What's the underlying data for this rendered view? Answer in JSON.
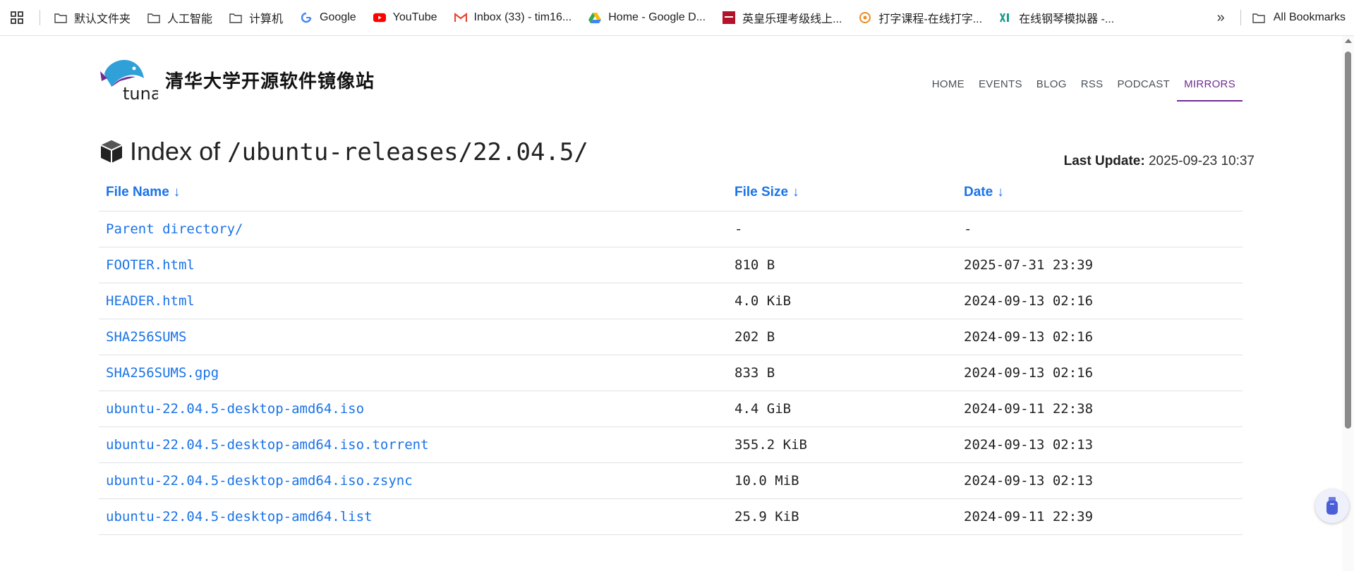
{
  "bookmarks": {
    "items": [
      {
        "label": "默认文件夹",
        "icon": "folder-icon"
      },
      {
        "label": "人工智能",
        "icon": "folder-icon"
      },
      {
        "label": "计算机",
        "icon": "folder-icon"
      },
      {
        "label": "Google",
        "icon": "google-icon"
      },
      {
        "label": "YouTube",
        "icon": "youtube-icon"
      },
      {
        "label": "Inbox (33) - tim16...",
        "icon": "gmail-icon"
      },
      {
        "label": "Home - Google D...",
        "icon": "google-drive-icon"
      },
      {
        "label": "英皇乐理考级线上...",
        "icon": "abrsm-icon"
      },
      {
        "label": "打字课程-在线打字...",
        "icon": "typing-icon"
      },
      {
        "label": "在线钢琴模拟器 -...",
        "icon": "piano-icon"
      }
    ],
    "all_bookmarks": "All Bookmarks"
  },
  "site": {
    "logo_text": "tuna",
    "title": "清华大学开源软件镜像站",
    "nav": [
      "HOME",
      "EVENTS",
      "BLOG",
      "RSS",
      "PODCAST",
      "MIRRORS"
    ],
    "active_nav": "MIRRORS",
    "accent_color": "#6f2d91",
    "link_color": "#1a73e8"
  },
  "index": {
    "prefix": "Index of",
    "path": "/ubuntu-releases/22.04.5/",
    "last_update_label": "Last Update:",
    "last_update_value": "2025-09-23 10:37"
  },
  "table": {
    "headers": [
      "File Name",
      "File Size",
      "Date"
    ],
    "sort_arrow": "↓",
    "rows": [
      {
        "name": "Parent directory/",
        "size": "-",
        "date": "-"
      },
      {
        "name": "FOOTER.html",
        "size": "810 B",
        "date": "2025-07-31 23:39"
      },
      {
        "name": "HEADER.html",
        "size": "4.0 KiB",
        "date": "2024-09-13 02:16"
      },
      {
        "name": "SHA256SUMS",
        "size": "202 B",
        "date": "2024-09-13 02:16"
      },
      {
        "name": "SHA256SUMS.gpg",
        "size": "833 B",
        "date": "2024-09-13 02:16"
      },
      {
        "name": "ubuntu-22.04.5-desktop-amd64.iso",
        "size": "4.4 GiB",
        "date": "2024-09-11 22:38"
      },
      {
        "name": "ubuntu-22.04.5-desktop-amd64.iso.torrent",
        "size": "355.2 KiB",
        "date": "2024-09-13 02:13"
      },
      {
        "name": "ubuntu-22.04.5-desktop-amd64.iso.zsync",
        "size": "10.0 MiB",
        "date": "2024-09-13 02:13"
      },
      {
        "name": "ubuntu-22.04.5-desktop-amd64.list",
        "size": "25.9 KiB",
        "date": "2024-09-11 22:39"
      }
    ]
  }
}
